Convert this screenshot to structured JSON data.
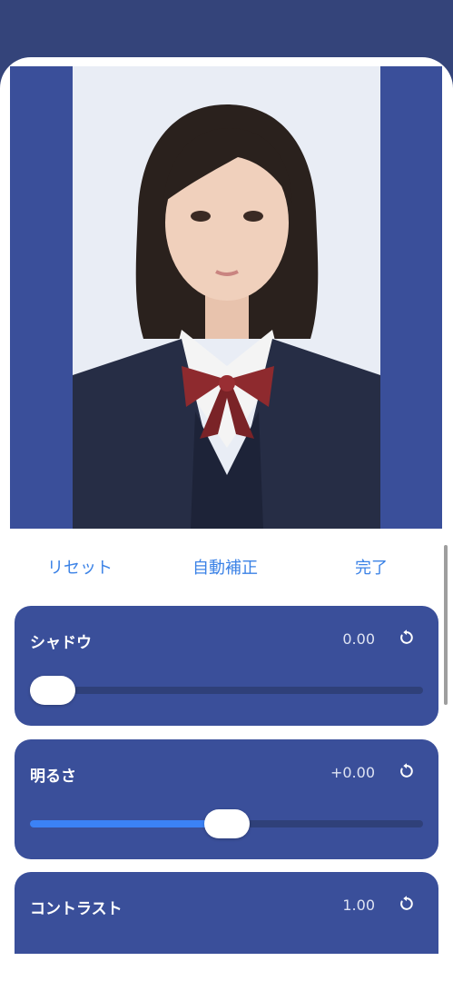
{
  "actions": {
    "reset_label": "リセット",
    "auto_label": "自動補正",
    "done_label": "完了"
  },
  "adjustments": [
    {
      "label": "シャドウ",
      "value": "0.00",
      "level": 0.0,
      "fill": false
    },
    {
      "label": "明るさ",
      "value": "+0.00",
      "level": 0.5,
      "fill": true
    },
    {
      "label": "コントラスト",
      "value": "1.00"
    }
  ],
  "icons": {
    "reset": "reset-icon"
  },
  "colors": {
    "accent": "#3b82e6",
    "card": "#3a4f9a",
    "header": "#34447a"
  }
}
